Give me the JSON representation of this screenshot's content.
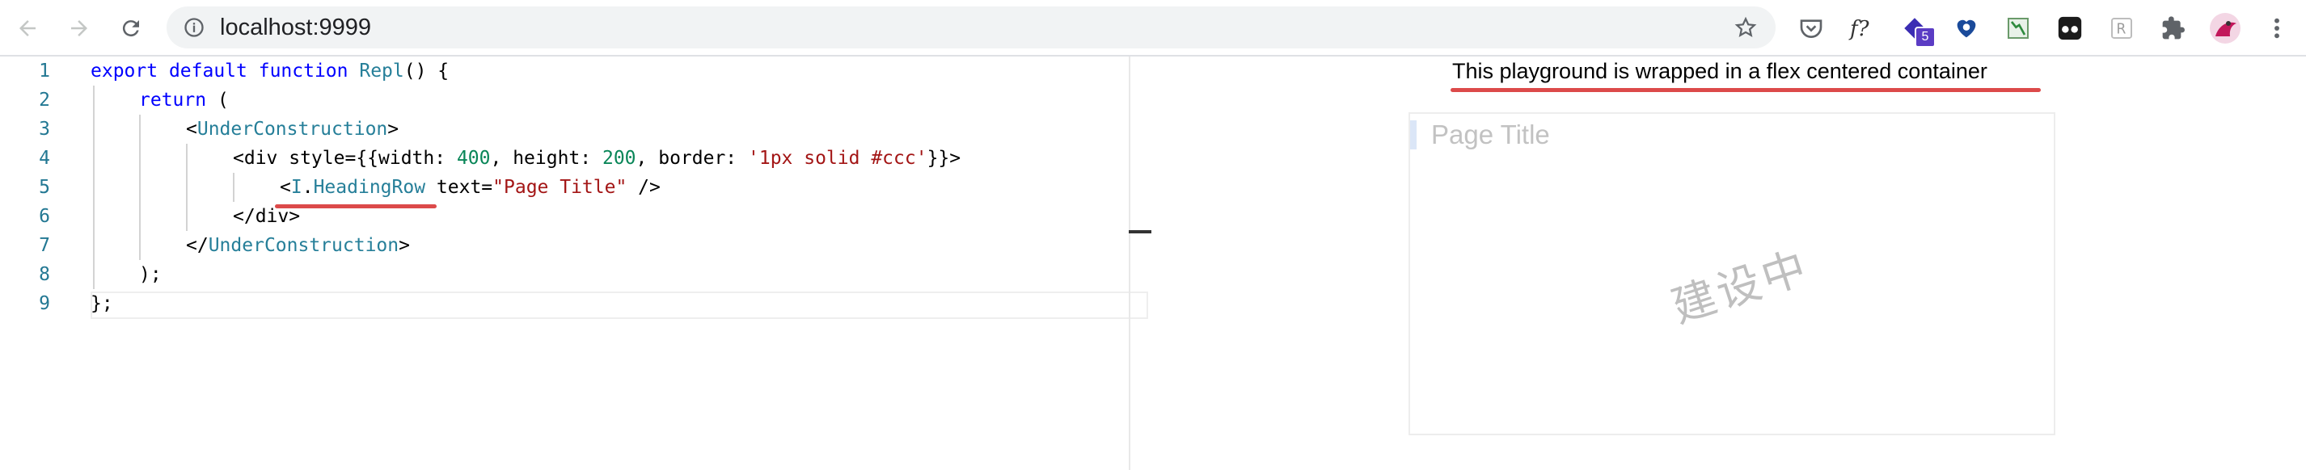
{
  "browser": {
    "url": "localhost:9999",
    "extension_badge_count": "5",
    "extensions": [
      "pocket-icon",
      "fx-icon",
      "stack-icon",
      "heart-key-icon",
      "sheets-icon",
      "glasses-icon",
      "r-icon",
      "puzzle-icon",
      "profile-avatar",
      "menu-dots-icon"
    ]
  },
  "editor": {
    "line_numbers": [
      "1",
      "2",
      "3",
      "4",
      "5",
      "6",
      "7",
      "8",
      "9"
    ],
    "lines": [
      {
        "t1": "export",
        "t2": " default",
        "t3": " function",
        "t4": " Repl",
        "t5": "() {"
      },
      {
        "t1": "return",
        "t2": " ("
      },
      {
        "t1": "<",
        "t2": "UnderConstruction",
        "t3": ">"
      },
      {
        "t1": "<div style={{width: ",
        "t2": "400",
        "t3": ", height: ",
        "t4": "200",
        "t5": ", border: ",
        "t6": "'1px solid #ccc'",
        "t7": "}}>"
      },
      {
        "t1": "<",
        "t2": "I",
        "t3": ".",
        "t4": "HeadingRow",
        "t5": " text=",
        "t6": "\"Page Title\"",
        "t7": " />"
      },
      {
        "t1": "</div>"
      },
      {
        "t1": "</",
        "t2": "UnderConstruction",
        "t3": ">"
      },
      {
        "t1": ");"
      },
      {
        "t1": "};"
      }
    ]
  },
  "preview": {
    "note": "This playground is wrapped in a flex centered container",
    "heading_text": "Page Title",
    "watermark": "建设中"
  },
  "colors": {
    "keyword": "#0000ff",
    "component": "#267f99",
    "string": "#a31515",
    "number": "#098658",
    "annotation_underline": "#dc4a4a"
  }
}
